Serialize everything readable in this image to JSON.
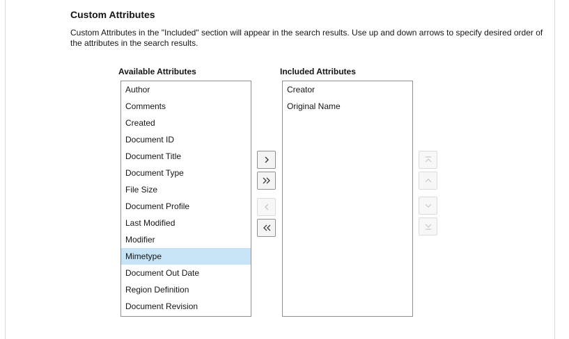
{
  "section": {
    "title": "Custom Attributes",
    "description": "Custom Attributes in the \"Included\" section will appear in the search results. Use up and down arrows to specify desired order of the attributes in the search results."
  },
  "available": {
    "label": "Available Attributes",
    "items": [
      "Author",
      "Comments",
      "Created",
      "Document ID",
      "Document Title",
      "Document Type",
      "File Size",
      "Document Profile",
      "Last Modified",
      "Modifier",
      "Mimetype",
      "Document Out Date",
      "Region Definition",
      "Document Revision"
    ],
    "selected": "Mimetype"
  },
  "included": {
    "label": "Included Attributes",
    "items": [
      "Creator",
      "Original Name"
    ]
  },
  "shuttle_buttons": {
    "move_right": "chevron-right-icon",
    "move_all_right": "double-chevron-right-icon",
    "move_left": "chevron-left-icon",
    "move_all_left": "double-chevron-left-icon"
  },
  "order_buttons": {
    "move_top": "arrow-to-top-icon",
    "move_up": "chevron-up-icon",
    "move_down": "chevron-down-icon",
    "move_bottom": "arrow-to-bottom-icon"
  },
  "colors": {
    "selected_row": "#c7e4f7",
    "border": "#8f8f8f",
    "disabled": "#c8c8c8"
  }
}
